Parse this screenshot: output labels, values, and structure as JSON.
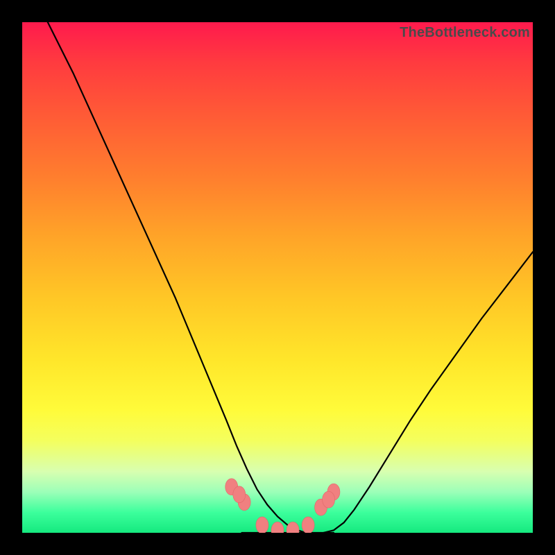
{
  "watermark": "TheBottleneck.com",
  "colors": {
    "frame": "#000000",
    "marker_fill": "#f08080",
    "marker_stroke": "#e06868",
    "curve_stroke": "#000000"
  },
  "chart_data": {
    "type": "line",
    "title": "",
    "xlabel": "",
    "ylabel": "",
    "xlim": [
      0,
      100
    ],
    "ylim": [
      0,
      100
    ],
    "grid": false,
    "legend": false,
    "series": [
      {
        "name": "bottleneck-curve-left",
        "x": [
          5,
          10,
          15,
          20,
          25,
          30,
          35,
          40,
          42,
          44,
          46,
          48,
          50,
          52,
          54,
          55.5
        ],
        "y": [
          100,
          90,
          79,
          68,
          57,
          46,
          34,
          22,
          17,
          12.5,
          8.5,
          5.5,
          3.2,
          1.5,
          0.5,
          0
        ]
      },
      {
        "name": "bottleneck-curve-valley",
        "x": [
          43,
          45,
          47,
          49,
          51,
          53,
          55,
          57,
          59,
          61
        ],
        "y": [
          0,
          0,
          0,
          0,
          0,
          0,
          0,
          0,
          0,
          0
        ]
      },
      {
        "name": "bottleneck-curve-right",
        "x": [
          59,
          61,
          63,
          65,
          68,
          72,
          76,
          80,
          85,
          90,
          95,
          100
        ],
        "y": [
          0,
          0.5,
          2,
          4.5,
          9,
          15.5,
          22,
          28,
          35,
          42,
          48.5,
          55
        ]
      }
    ],
    "markers": {
      "name": "valley-markers",
      "x": [
        41,
        43.5,
        47,
        50,
        53,
        56,
        58.5,
        61,
        42.5,
        60
      ],
      "y": [
        9,
        6,
        1.5,
        0.5,
        0.5,
        1.5,
        5,
        8,
        7.5,
        6.5
      ]
    }
  }
}
